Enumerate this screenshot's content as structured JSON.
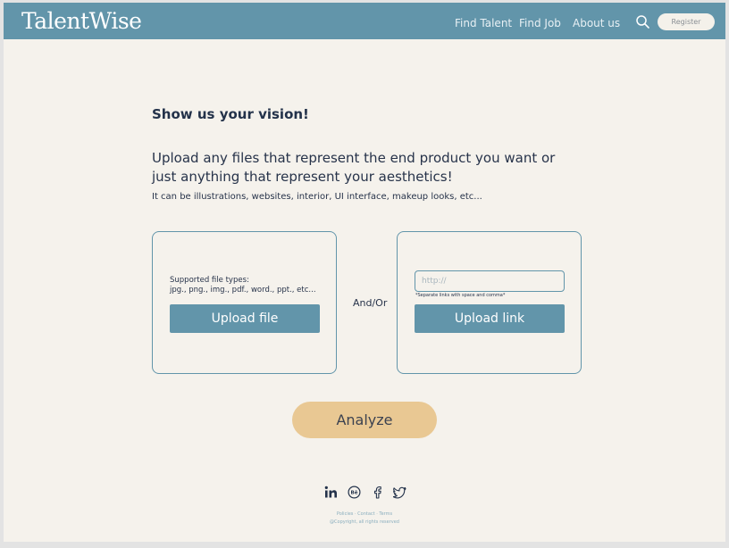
{
  "header": {
    "logo": "TalentWise",
    "nav": [
      "Find Talent",
      "Find Job",
      "About us"
    ],
    "search_icon": "search-icon",
    "register_label": "Register"
  },
  "main": {
    "heading": "Show us your vision!",
    "lead": "Upload any files that represent the end product you want or just anything that represent your aesthetics!",
    "sub": "It can be illustrations, websites, interior, UI interface, makeup looks, etc...",
    "file_panel": {
      "types_label": "Supported file types:",
      "types_list": "jpg., png., img., pdf., word., ppt., etc...",
      "upload_label": "Upload file"
    },
    "connector": "And/Or",
    "link_panel": {
      "placeholder": "http://",
      "hint": "*Separate links with space and comma*",
      "upload_label": "Upload link"
    },
    "analyze_label": "Analyze"
  },
  "footer": {
    "social_icons": [
      "linkedin-icon",
      "behance-icon",
      "facebook-icon",
      "twitter-icon"
    ],
    "links": "Policies · Contact · Terms",
    "copyright": "@Copyright, all rights reserved"
  },
  "colors": {
    "brand": "#6295aa",
    "background": "#f5f2ec",
    "accent": "#e9c893",
    "text": "#27334a"
  }
}
